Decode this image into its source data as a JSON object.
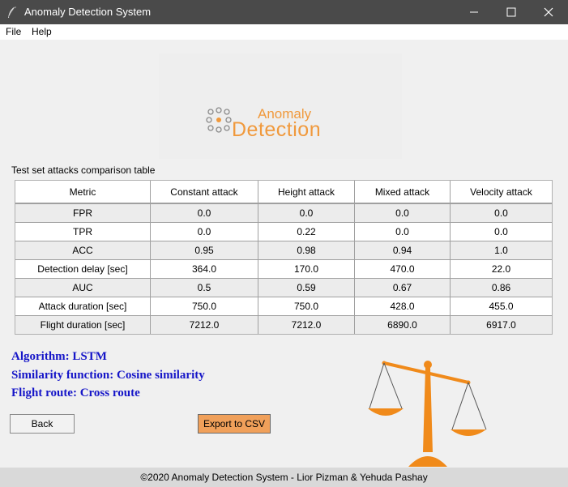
{
  "window": {
    "title": "Anomaly Detection System",
    "minimize_glyph": "—",
    "close_glyph": "✕"
  },
  "menu": {
    "file": "File",
    "help": "Help"
  },
  "logo": {
    "line1": "Anomaly",
    "line2": "Detection",
    "color": "#f0993c"
  },
  "table": {
    "caption": "Test set attacks comparison table",
    "headers": [
      "Metric",
      "Constant attack",
      "Height attack",
      "Mixed attack",
      "Velocity attack"
    ],
    "rows": [
      [
        "FPR",
        "0.0",
        "0.0",
        "0.0",
        "0.0"
      ],
      [
        "TPR",
        "0.0",
        "0.22",
        "0.0",
        "0.0"
      ],
      [
        "ACC",
        "0.95",
        "0.98",
        "0.94",
        "1.0"
      ],
      [
        "Detection delay [sec]",
        "364.0",
        "170.0",
        "470.0",
        "22.0"
      ],
      [
        "AUC",
        "0.5",
        "0.59",
        "0.67",
        "0.86"
      ],
      [
        "Attack duration [sec]",
        "750.0",
        "750.0",
        "428.0",
        "455.0"
      ],
      [
        "Flight duration [sec]",
        "7212.0",
        "7212.0",
        "6890.0",
        "6917.0"
      ]
    ]
  },
  "info": {
    "algorithm": "Algorithm: LSTM",
    "similarity": "Similarity function: Cosine similarity",
    "route": "Flight route: Cross route",
    "color": "#1515c8"
  },
  "buttons": {
    "back": "Back",
    "export": "Export to CSV",
    "export_color": "#f0a05a"
  },
  "footer": {
    "text": "©2020 Anomaly Detection System - Lior Pizman & Yehuda Pashay"
  },
  "icons": [
    "feather-icon",
    "minimize-icon",
    "maximize-icon",
    "close-icon",
    "anomaly-dots-icon",
    "balance-scale-icon"
  ]
}
